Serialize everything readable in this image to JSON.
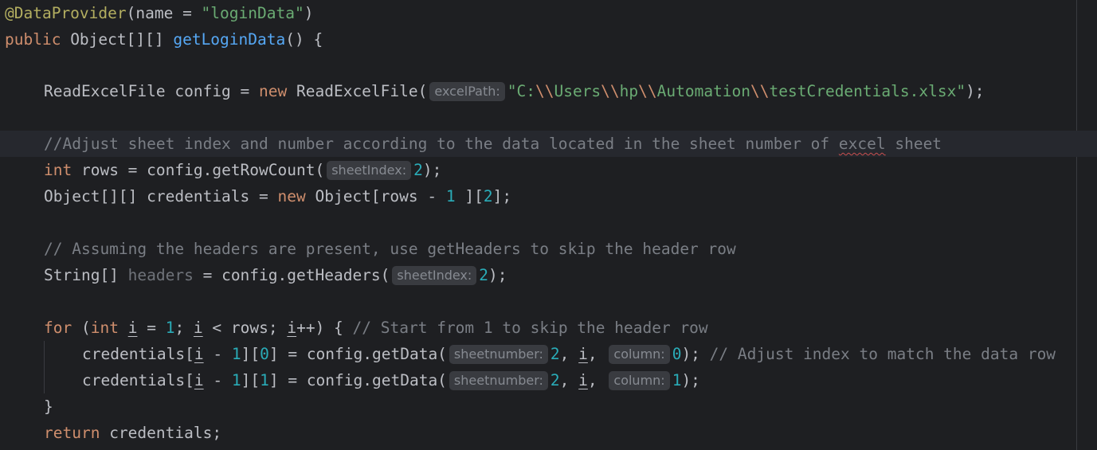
{
  "code": {
    "l1": {
      "annotation": "@DataProvider",
      "open": "(name = ",
      "name": "\"loginData\"",
      "close": ")"
    },
    "l2": {
      "kw": "public",
      "type": " Object[][] ",
      "method": "getLoginData",
      "rest": "() {"
    },
    "l4": {
      "decl": "ReadExcelFile config = ",
      "kw": "new",
      "ctor": " ReadExcelFile(",
      "hint": "excelPath:",
      "s1": "\"C:",
      "e1": "\\\\",
      "s2": "Users",
      "e2": "\\\\",
      "s3": "hp",
      "e3": "\\\\",
      "s4": "Automation",
      "e4": "\\\\",
      "s5": "testCredentials.xlsx\"",
      "end": ");"
    },
    "l6": {
      "comment_pre": "//Adjust sheet index and number according to the data located in the sheet number of ",
      "typo_word": "excel",
      "comment_post": " sheet"
    },
    "l7": {
      "kw": "int",
      "mid": " rows = config.getRowCount(",
      "hint": "sheetIndex:",
      "num": "2",
      "end": ");"
    },
    "l8": {
      "decl": "Object[][] credentials = ",
      "kw": "new",
      "mid": " Object[rows - ",
      "n1": "1",
      "mid2": " ][",
      "n2": "2",
      "end": "];"
    },
    "l10": {
      "comment": "// Assuming the headers are present, use getHeaders to skip the header row"
    },
    "l11": {
      "type": "String[] ",
      "var": "headers",
      "mid": " = config.getHeaders(",
      "hint": "sheetIndex:",
      "num": "2",
      "end": ");"
    },
    "l13": {
      "kw_for": "for",
      "p1": " (",
      "kw_int": "int",
      "sp": " ",
      "i1": "i",
      "eq": " = ",
      "n1": "1",
      "semi": "; ",
      "i2": "i",
      "lt": " < rows; ",
      "i3": "i",
      "inc": "++) { ",
      "comment": "// Start from 1 to skip the header row"
    },
    "l14": {
      "pre": "credentials[",
      "i1": "i",
      "minus": " - ",
      "n1": "1",
      "br": "][",
      "n0": "0",
      "mid": "] = config.getData(",
      "hint1": "sheetnumber:",
      "n2": "2",
      "comma": ", ",
      "i2": "i",
      "comma2": ", ",
      "hint2": "column:",
      "n3": "0",
      "end": "); ",
      "comment": "// Adjust index to match the data row"
    },
    "l15": {
      "pre": "credentials[",
      "i1": "i",
      "minus": " - ",
      "n1": "1",
      "br": "][",
      "n0": "1",
      "mid": "] = config.getData(",
      "hint1": "sheetnumber:",
      "n2": "2",
      "comma": ", ",
      "i2": "i",
      "comma2": ", ",
      "hint2": "column:",
      "n3": "1",
      "end": ");"
    },
    "l16": {
      "brace": "}"
    },
    "l17": {
      "kw": "return",
      "rest": " credentials;"
    }
  },
  "colors": {
    "background": "#1e1f22",
    "keyword": "#cf8e6d",
    "string": "#6aab73",
    "number": "#2aacb8",
    "comment": "#7a7e85",
    "method": "#56a8f5",
    "annotation": "#b3ae60",
    "hint_bg": "#393b40"
  }
}
